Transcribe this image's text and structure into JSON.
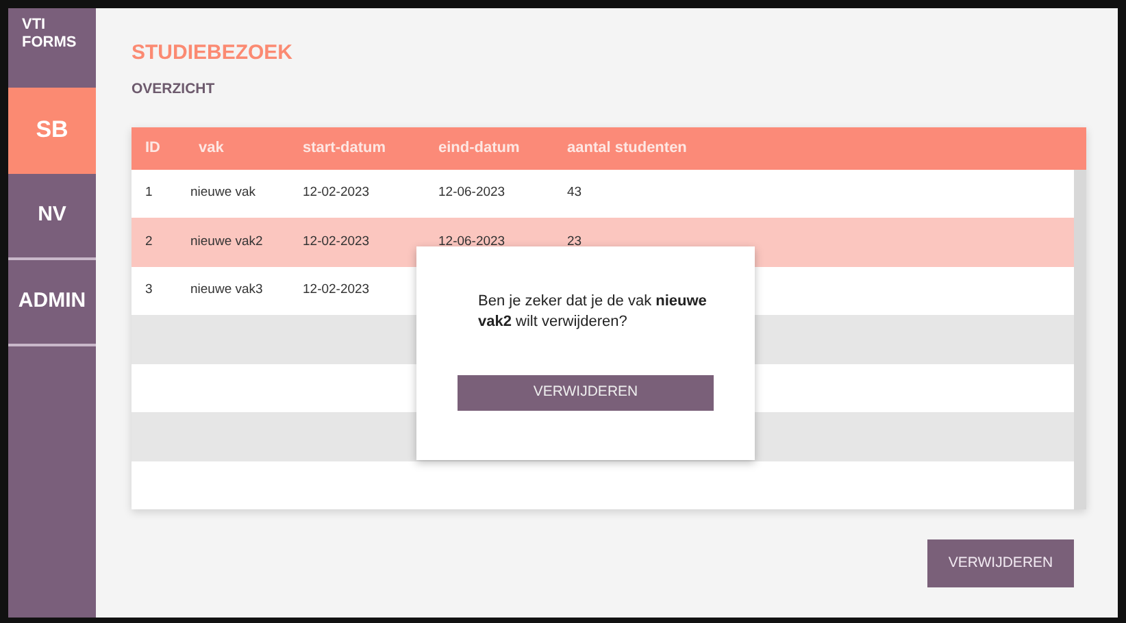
{
  "sidebar": {
    "logo": "VTI FORMS",
    "items": [
      {
        "label": "SB",
        "selected": true
      },
      {
        "label": "NV",
        "selected": false
      },
      {
        "label": "ADMIN",
        "selected": false
      }
    ]
  },
  "page": {
    "title": "STUDIEBEZOEK",
    "subtitle": "OVERZICHT"
  },
  "table": {
    "columns": [
      "ID",
      "vak",
      "start-datum",
      "eind-datum",
      "aantal studenten"
    ],
    "rows": [
      {
        "kind": "data",
        "selected": false,
        "cells": [
          "1",
          "nieuwe vak",
          "12-02-2023",
          "12-06-2023",
          "43"
        ]
      },
      {
        "kind": "data",
        "selected": true,
        "cells": [
          "2",
          "nieuwe vak2",
          "12-02-2023",
          "12-06-2023",
          "23"
        ]
      },
      {
        "kind": "data",
        "selected": false,
        "cells": [
          "3",
          "nieuwe vak3",
          "12-02-2023"
        ]
      },
      {
        "kind": "blank"
      },
      {
        "kind": "blank"
      },
      {
        "kind": "blank"
      },
      {
        "kind": "blank"
      }
    ]
  },
  "dialog": {
    "message": "Ben je zeker dat je de vak **nieuwe vak2** wilt verwijderen?",
    "button": "VERWIJDEREN"
  },
  "delete_button": "VERWIJDEREN"
}
